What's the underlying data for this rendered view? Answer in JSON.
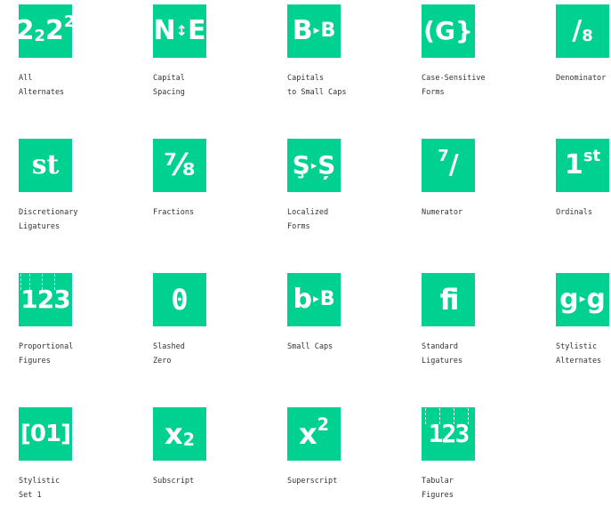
{
  "accent_color": "#00d190",
  "features": [
    {
      "label": "All\nAlternates",
      "glyph": {
        "base": "2",
        "sub": "2",
        "sup": "2",
        "sup2": "2"
      }
    },
    {
      "label": "Capital\nSpacing",
      "glyph": {
        "left": "N",
        "mid": "↕",
        "right": "E"
      }
    },
    {
      "label": "Capitals\nto Small Caps",
      "glyph": {
        "left": "B",
        "arrow": "▸",
        "right": "B"
      }
    },
    {
      "label": "Case-Sensitive\nForms",
      "glyph": {
        "text": "(G}"
      }
    },
    {
      "label": "Denominator",
      "glyph": {
        "slash": "/",
        "den": "8"
      }
    },
    {
      "label": "Discretionary\nLigatures",
      "glyph": {
        "text": "st"
      }
    },
    {
      "label": "Fractions",
      "glyph": {
        "text": "⅞"
      }
    },
    {
      "label": "Localized\nForms",
      "glyph": {
        "left": "Ş",
        "arrow": "▸",
        "right": "Ș"
      }
    },
    {
      "label": "Numerator",
      "glyph": {
        "num": "7",
        "slash": "/"
      }
    },
    {
      "label": "Ordinals",
      "glyph": {
        "base": "1",
        "sup": "st"
      }
    },
    {
      "label": "Proportional\nFigures",
      "glyph": {
        "text": "123"
      }
    },
    {
      "label": "Slashed\nZero",
      "glyph": {
        "text": "0"
      }
    },
    {
      "label": "Small Caps",
      "glyph": {
        "left": "b",
        "arrow": "▸",
        "right": "B"
      }
    },
    {
      "label": "Standard\nLigatures",
      "glyph": {
        "text": "fi"
      }
    },
    {
      "label": "Stylistic\nAlternates",
      "glyph": {
        "left": "g",
        "arrow": "▸",
        "right": "g"
      }
    },
    {
      "label": "Stylistic\nSet 1",
      "glyph": {
        "text": "[01]"
      }
    },
    {
      "label": "Subscript",
      "glyph": {
        "base": "x",
        "sub": "2"
      }
    },
    {
      "label": "Superscript",
      "glyph": {
        "base": "x",
        "sup": "2"
      }
    },
    {
      "label": "Tabular\nFigures",
      "glyph": {
        "text": "123"
      }
    }
  ]
}
